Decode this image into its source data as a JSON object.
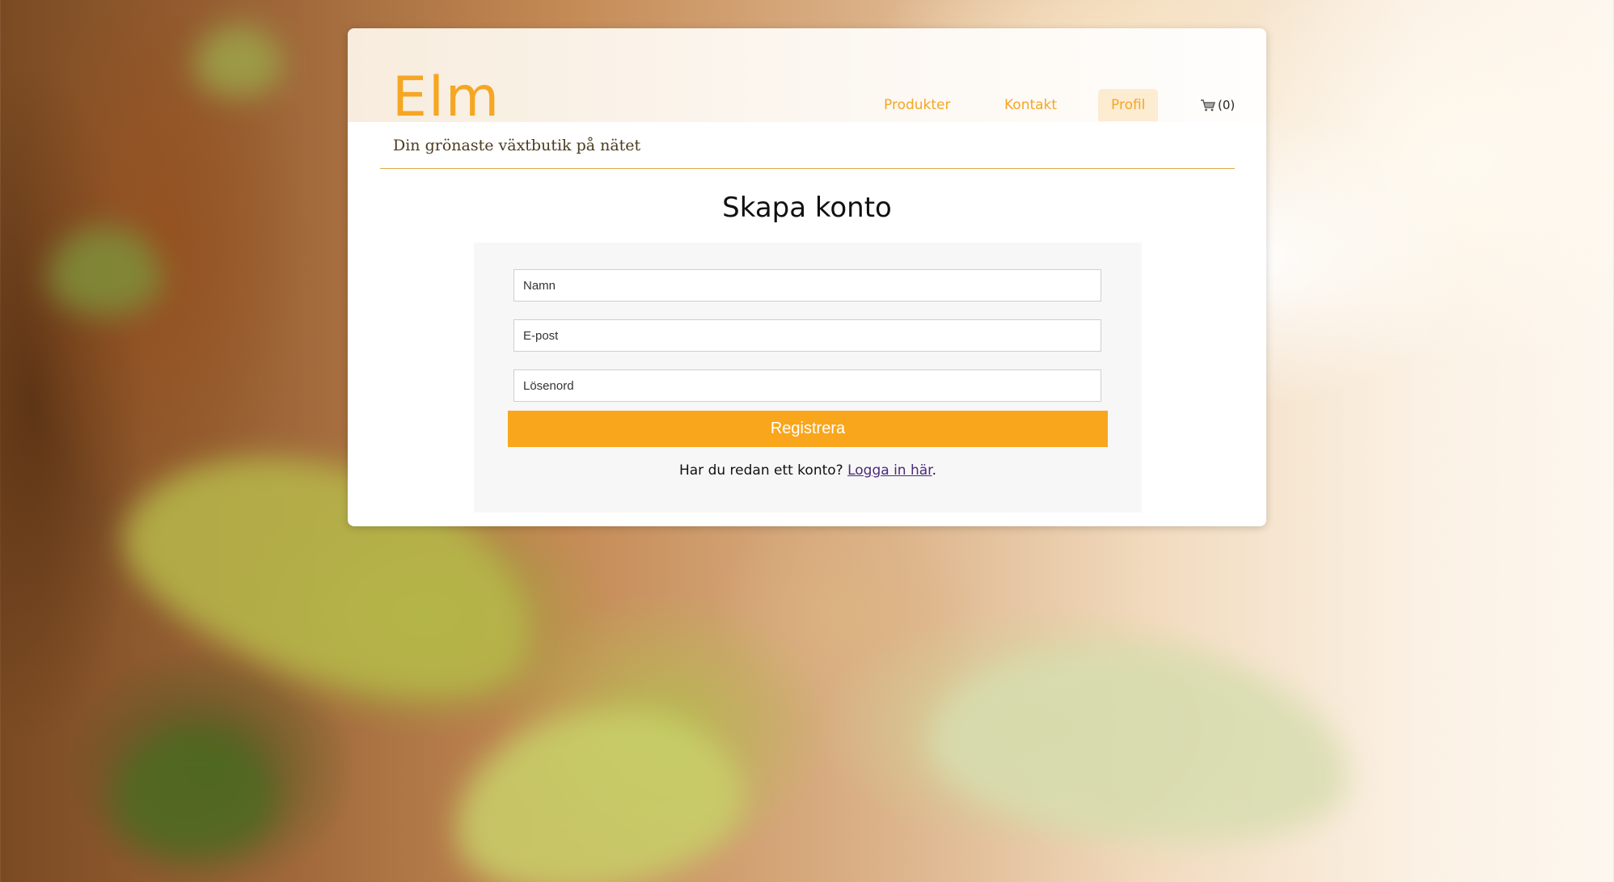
{
  "header": {
    "logo": "Elm",
    "tagline": "Din grönaste växtbutik på nätet"
  },
  "nav": {
    "items": [
      {
        "label": "Produkter",
        "active": false
      },
      {
        "label": "Kontakt",
        "active": false
      },
      {
        "label": "Profil",
        "active": true
      }
    ],
    "cart": {
      "icon": "shopping-cart-icon",
      "count_label": "(0)"
    }
  },
  "main": {
    "title": "Skapa konto",
    "form": {
      "name_placeholder": "Namn",
      "email_placeholder": "E-post",
      "password_placeholder": "Lösenord",
      "submit_label": "Registrera",
      "login_prompt": "Har du redan ett konto?",
      "login_link": "Logga in här",
      "login_suffix": "."
    }
  },
  "colors": {
    "accent": "#f9a61d",
    "link": "#4b2a7a",
    "divider": "#e2a84a"
  }
}
